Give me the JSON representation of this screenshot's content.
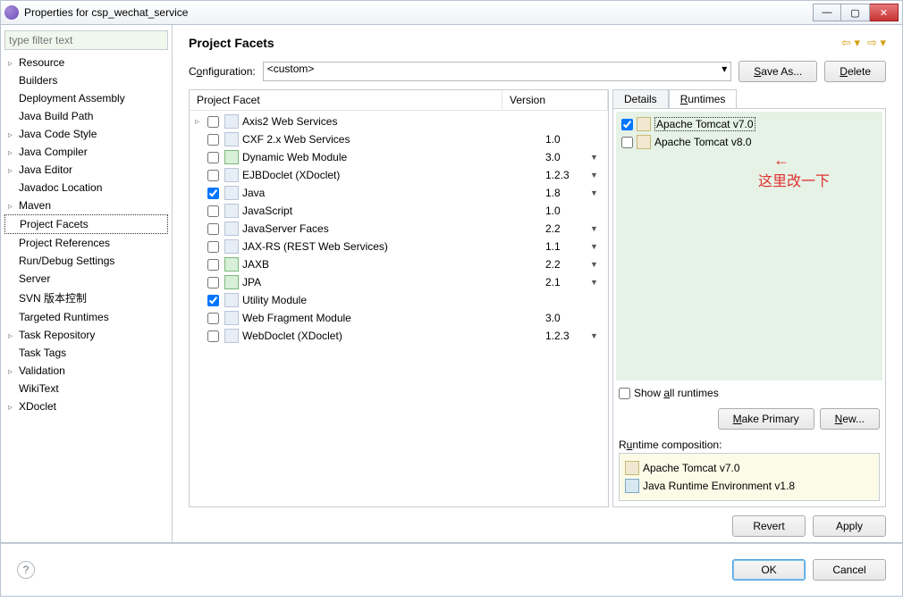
{
  "window": {
    "title": "Properties for csp_wechat_service",
    "min": "—",
    "max": "▢",
    "close": "✕"
  },
  "filter_placeholder": "type filter text",
  "sidebar": [
    {
      "label": "Resource",
      "exp": true
    },
    {
      "label": "Builders"
    },
    {
      "label": "Deployment Assembly"
    },
    {
      "label": "Java Build Path"
    },
    {
      "label": "Java Code Style",
      "exp": true
    },
    {
      "label": "Java Compiler",
      "exp": true
    },
    {
      "label": "Java Editor",
      "exp": true
    },
    {
      "label": "Javadoc Location"
    },
    {
      "label": "Maven",
      "exp": true
    },
    {
      "label": "Project Facets",
      "selected": true
    },
    {
      "label": "Project References"
    },
    {
      "label": "Run/Debug Settings"
    },
    {
      "label": "Server"
    },
    {
      "label": "SVN 版本控制"
    },
    {
      "label": "Targeted Runtimes"
    },
    {
      "label": "Task Repository",
      "exp": true
    },
    {
      "label": "Task Tags"
    },
    {
      "label": "Validation",
      "exp": true
    },
    {
      "label": "WikiText"
    },
    {
      "label": "XDoclet",
      "exp": true
    }
  ],
  "content": {
    "title": "Project Facets",
    "config_label_pre": "C",
    "config_label_u": "o",
    "config_label_post": "nfiguration:",
    "config_value": "<custom>",
    "save_as": "Save As...",
    "save_u": "S",
    "delete": "Delete",
    "delete_u": "D",
    "table_head_name": "Project Facet",
    "table_head_ver": "Version",
    "facets": [
      {
        "name": "Axis2 Web Services",
        "ver": "",
        "dd": false,
        "checked": false,
        "toggle": true
      },
      {
        "name": "CXF 2.x Web Services",
        "ver": "1.0",
        "dd": false,
        "checked": false
      },
      {
        "name": "Dynamic Web Module",
        "ver": "3.0",
        "dd": true,
        "checked": false,
        "icon": "green"
      },
      {
        "name": "EJBDoclet (XDoclet)",
        "ver": "1.2.3",
        "dd": true,
        "checked": false
      },
      {
        "name": "Java",
        "ver": "1.8",
        "dd": true,
        "checked": true
      },
      {
        "name": "JavaScript",
        "ver": "1.0",
        "dd": false,
        "checked": false
      },
      {
        "name": "JavaServer Faces",
        "ver": "2.2",
        "dd": true,
        "checked": false
      },
      {
        "name": "JAX-RS (REST Web Services)",
        "ver": "1.1",
        "dd": true,
        "checked": false
      },
      {
        "name": "JAXB",
        "ver": "2.2",
        "dd": true,
        "checked": false,
        "icon": "green"
      },
      {
        "name": "JPA",
        "ver": "2.1",
        "dd": true,
        "checked": false,
        "icon": "green"
      },
      {
        "name": "Utility Module",
        "ver": "",
        "dd": false,
        "checked": true
      },
      {
        "name": "Web Fragment Module",
        "ver": "3.0",
        "dd": false,
        "checked": false
      },
      {
        "name": "WebDoclet (XDoclet)",
        "ver": "1.2.3",
        "dd": true,
        "checked": false
      }
    ],
    "tabs": {
      "details": "Details",
      "runtimes": "Runtimes",
      "runtimes_u": "R"
    },
    "runtimes": [
      {
        "label": "Apache Tomcat v7.0",
        "checked": true,
        "selected": true
      },
      {
        "label": "Apache Tomcat v8.0",
        "checked": false
      }
    ],
    "show_all_pre": "Show ",
    "show_all_u": "a",
    "show_all_post": "ll runtimes",
    "make_primary": "Make Primary",
    "make_primary_u": "M",
    "new_btn": "New...",
    "new_u": "N",
    "rc_label_pre": "R",
    "rc_label_u": "u",
    "rc_label_post": "ntime composition:",
    "rc_items": [
      {
        "label": "Apache Tomcat v7.0",
        "icon": "tomcat"
      },
      {
        "label": "Java Runtime Environment v1.8",
        "icon": "jre"
      }
    ],
    "revert": "Revert",
    "apply": "Apply"
  },
  "footer": {
    "ok": "OK",
    "cancel": "Cancel",
    "help": "?"
  },
  "annotation": {
    "arrow": "←",
    "text": "这里改一下"
  }
}
